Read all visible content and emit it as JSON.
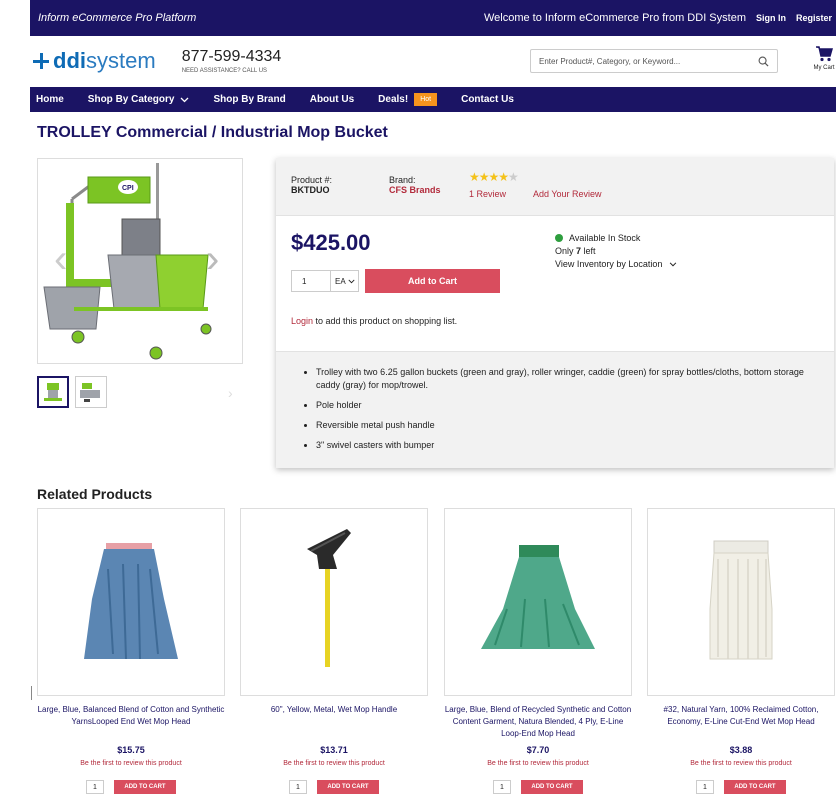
{
  "topbar": {
    "brand": "Inform eCommerce Pro Platform",
    "welcome": "Welcome to Inform eCommerce Pro from DDI System",
    "sign_in": "Sign In",
    "register": "Register"
  },
  "header": {
    "logo_ddi": "ddi",
    "logo_system": "system",
    "phone": "877-599-4334",
    "phone_sub": "NEED ASSISTANCE? CALL US",
    "search_placeholder": "Enter Product#, Category, or Keyword...",
    "cart_label": "My Cart"
  },
  "nav": {
    "home": "Home",
    "shop_category": "Shop By Category",
    "shop_brand": "Shop By Brand",
    "about": "About Us",
    "deals": "Deals!",
    "hot": "Hot",
    "contact": "Contact Us"
  },
  "product": {
    "title": "TROLLEY Commercial / Industrial Mop Bucket",
    "product_num_label": "Product #:",
    "product_num": "BKTDUO",
    "brand_label": "Brand:",
    "brand": "CFS Brands",
    "rating": 4,
    "reviews": "1 Review",
    "add_review": "Add Your Review",
    "price": "$425.00",
    "availability": "Available In Stock",
    "only_prefix": "Only ",
    "only_count": "7",
    "only_suffix": " left",
    "inventory_link": "View Inventory by Location",
    "qty": "1",
    "uom": "EA",
    "add_to_cart": "Add to Cart",
    "login_link": "Login",
    "login_text": " to add this product on shopping list.",
    "features": [
      "Trolley with two 6.25 gallon buckets (green and gray), roller wringer, caddie (green) for spray bottles/cloths, bottom storage caddy (gray) for mop/trowel.",
      "Pole holder",
      "Reversible metal push handle",
      "3\" swivel casters with bumper"
    ],
    "bucket_logo": "CPI"
  },
  "related": {
    "title": "Related Products",
    "review_text": "Be the first to review this product",
    "qty": "1",
    "add_label": "ADD TO CART",
    "items": [
      {
        "name": "Large, Blue, Balanced Blend of Cotton and Synthetic YarnsLooped End Wet Mop Head",
        "price": "$15.75"
      },
      {
        "name": "60\", Yellow, Metal, Wet Mop Handle",
        "price": "$13.71"
      },
      {
        "name": "Large, Blue, Blend of Recycled Synthetic and Cotton Content Garment, Natura Blended, 4 Ply, E-Line Loop-End Mop Head",
        "price": "$7.70"
      },
      {
        "name": "#32, Natural Yarn, 100% Reclaimed Cotton, Economy, E-Line Cut-End Wet Mop Head",
        "price": "$3.88"
      }
    ]
  },
  "colors": {
    "navy": "#1b1464",
    "accent_red": "#d94d5e",
    "link_red": "#b22a3b",
    "hot_orange": "#f7941d",
    "stock_green": "#2e9e3e"
  }
}
